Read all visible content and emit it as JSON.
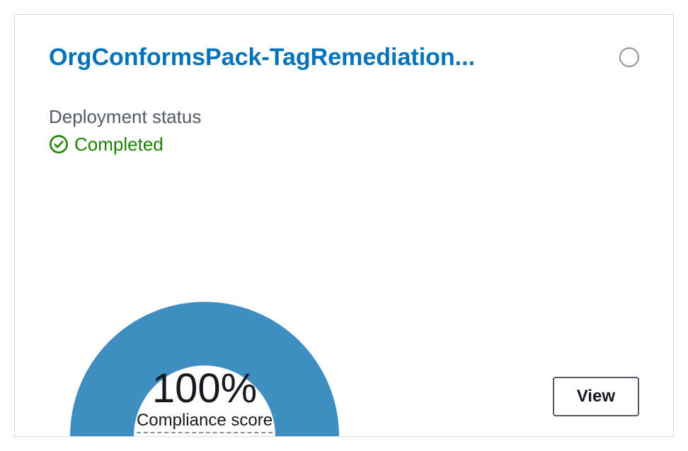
{
  "card": {
    "title": "OrgConformsPack-TagRemediation...",
    "status_label": "Deployment status",
    "status_value": "Completed",
    "view_button": "View"
  },
  "chart_data": {
    "type": "gauge",
    "value": 100,
    "display_value": "100%",
    "label": "Compliance score",
    "max": 100,
    "min": 0,
    "fill_color": "#3f8ec2"
  }
}
